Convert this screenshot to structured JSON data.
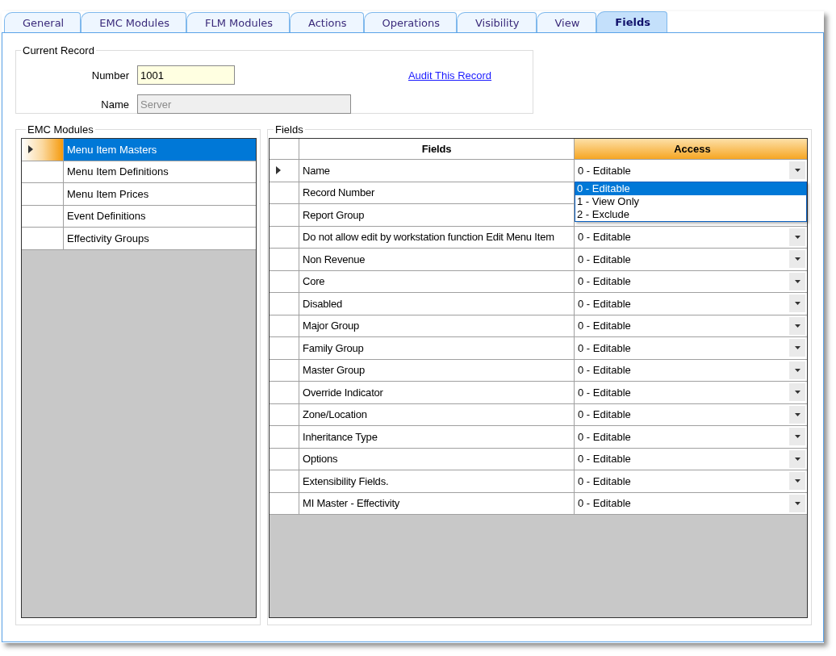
{
  "tabs": [
    {
      "label": "General",
      "selected": false
    },
    {
      "label": "EMC Modules",
      "selected": false
    },
    {
      "label": "FLM Modules",
      "selected": false
    },
    {
      "label": "Actions",
      "selected": false
    },
    {
      "label": "Operations",
      "selected": false
    },
    {
      "label": "Visibility",
      "selected": false
    },
    {
      "label": "View",
      "selected": false
    },
    {
      "label": "Fields",
      "selected": true
    }
  ],
  "current_record": {
    "title": "Current Record",
    "number_label": "Number",
    "number": "1001",
    "name_label": "Name",
    "name": "Server",
    "name_disabled": true,
    "audit_link": "Audit This Record"
  },
  "emc_modules": {
    "title": "EMC Modules",
    "items": [
      {
        "label": "Menu Item Masters",
        "selected": true
      },
      {
        "label": "Menu Item Definitions",
        "selected": false
      },
      {
        "label": "Menu Item Prices",
        "selected": false
      },
      {
        "label": "Event Definitions",
        "selected": false
      },
      {
        "label": "Effectivity Groups",
        "selected": false
      }
    ]
  },
  "fields": {
    "title": "Fields",
    "columns": [
      "Fields",
      "Access"
    ],
    "rows": [
      {
        "field": "Name",
        "access": "0 - Editable",
        "current": true,
        "dropdown": {
          "options": [
            {
              "label": "0 - Editable",
              "selected": true
            },
            {
              "label": "1 - View Only",
              "selected": false
            },
            {
              "label": "2 - Exclude",
              "selected": false
            }
          ]
        }
      },
      {
        "field": "Record Number",
        "current": false
      },
      {
        "field": "Report Group",
        "current": false
      },
      {
        "field": "Do not allow edit by workstation function Edit Menu Item",
        "access": "0 - Editable",
        "current": false
      },
      {
        "field": "Non Revenue",
        "access": "0 - Editable",
        "current": false
      },
      {
        "field": "Core",
        "access": "0 - Editable",
        "current": false
      },
      {
        "field": "Disabled",
        "access": "0 - Editable",
        "current": false
      },
      {
        "field": "Major Group",
        "access": "0 - Editable",
        "current": false
      },
      {
        "field": "Family Group",
        "access": "0 - Editable",
        "current": false
      },
      {
        "field": "Master Group",
        "access": "0 - Editable",
        "current": false
      },
      {
        "field": "Override Indicator",
        "access": "0 - Editable",
        "current": false
      },
      {
        "field": "Zone/Location",
        "access": "0 - Editable",
        "current": false
      },
      {
        "field": "Inheritance Type",
        "access": "0 - Editable",
        "current": false
      },
      {
        "field": "Options",
        "access": "0 - Editable",
        "current": false
      },
      {
        "field": "Extensibility Fields.",
        "access": "0 - Editable",
        "current": false
      },
      {
        "field": "MI Master - Effectivity",
        "access": "0 - Editable",
        "current": false
      }
    ]
  }
}
